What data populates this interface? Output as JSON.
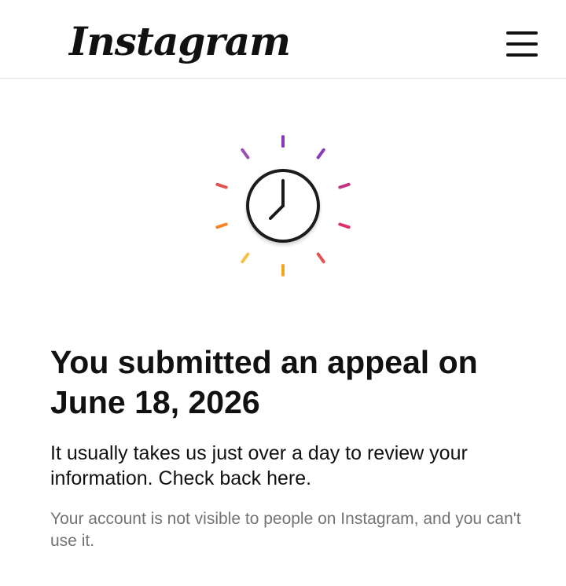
{
  "header": {
    "logo_text": "Instagram",
    "menu_icon": "hamburger-menu-icon"
  },
  "status_illustration": {
    "icon": "clock-icon",
    "ray_colors": [
      "#8a3ab9",
      "#8a3ab9",
      "#c13584",
      "#e1306c",
      "#e0554d",
      "#f5a623",
      "#f7c04a",
      "#f58529",
      "#e0554d",
      "#9b4fb5"
    ]
  },
  "main": {
    "headline": "You submitted an appeal on June 18, 2026",
    "description": "It usually takes us just over a day to review your information. Check back here.",
    "note": "Your account is not visible to people on Instagram, and you can't use it."
  }
}
